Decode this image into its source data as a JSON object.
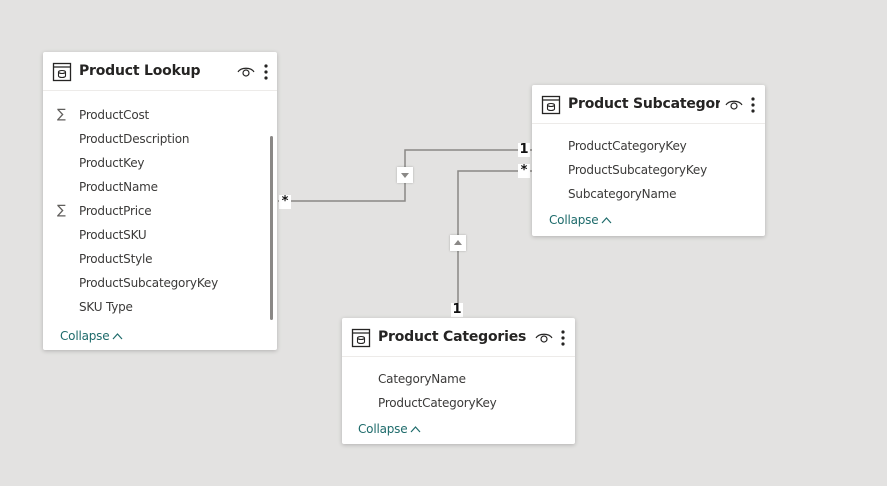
{
  "tables": {
    "product_lookup": {
      "title": "Product Lookup",
      "fields": [
        {
          "label": "ProductCost",
          "aggregate": true
        },
        {
          "label": "ProductDescription",
          "aggregate": false
        },
        {
          "label": "ProductKey",
          "aggregate": false
        },
        {
          "label": "ProductName",
          "aggregate": false
        },
        {
          "label": "ProductPrice",
          "aggregate": true
        },
        {
          "label": "ProductSKU",
          "aggregate": false
        },
        {
          "label": "ProductStyle",
          "aggregate": false
        },
        {
          "label": "ProductSubcategoryKey",
          "aggregate": false
        },
        {
          "label": "SKU Type",
          "aggregate": false
        }
      ],
      "collapse_label": "Collapse"
    },
    "product_subcategories": {
      "title": "Product Subcategorie...",
      "fields": [
        {
          "label": "ProductCategoryKey"
        },
        {
          "label": "ProductSubcategoryKey"
        },
        {
          "label": "SubcategoryName"
        }
      ],
      "collapse_label": "Collapse"
    },
    "product_categories": {
      "title": "Product Categories L...",
      "fields": [
        {
          "label": "CategoryName"
        },
        {
          "label": "ProductCategoryKey"
        }
      ],
      "collapse_label": "Collapse"
    }
  },
  "relationships": {
    "lookup_to_subcat": {
      "from_card": "*",
      "to_card": "1"
    },
    "categories_to_subcat": {
      "from_card": "1",
      "to_card": "*"
    }
  },
  "symbols": {
    "sigma": "∑",
    "chevron_up": "^"
  },
  "icons": [
    "table-icon",
    "eye-icon",
    "more-options-icon",
    "sigma-icon",
    "chevron-up-icon",
    "filter-direction-icon"
  ],
  "colors": {
    "canvas": "#e3e2e1",
    "card": "#ffffff",
    "collapse_link": "#1e6b6b",
    "relationship_line": "#8a8886"
  }
}
